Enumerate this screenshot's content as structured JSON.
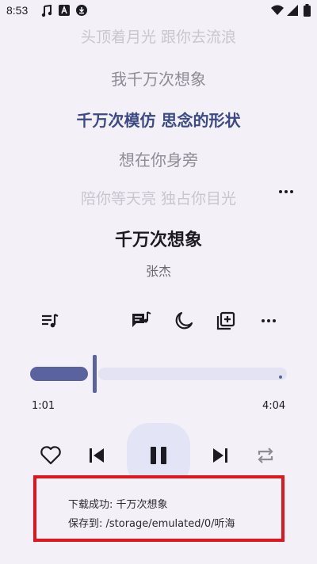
{
  "status_bar": {
    "time": "8:53",
    "left_icons": [
      "music-note-icon",
      "a-badge-icon",
      "download-circle-icon"
    ],
    "right_icons": [
      "wifi-icon",
      "signal-icon",
      "battery-icon"
    ]
  },
  "lyrics": {
    "lines": [
      "头顶着月光 跟你去流浪",
      "我千万次想象",
      "千万次模仿 思念的形状",
      "想在你身旁",
      "陪你等天亮 独占你目光"
    ],
    "active_index": 2
  },
  "song": {
    "title": "千万次想象",
    "artist": "张杰"
  },
  "toolbar": {
    "icons": [
      "playlist-icon",
      "lyrics-icon",
      "sleep-timer-icon",
      "add-to-playlist-icon",
      "more-icon"
    ]
  },
  "playback": {
    "current_time": "1:01",
    "total_time": "4:04",
    "progress_fraction": 0.25
  },
  "controls": {
    "icons": [
      "heart-icon",
      "previous-icon",
      "pause-icon",
      "next-icon",
      "repeat-icon"
    ]
  },
  "toast": {
    "line1": "下载成功: 千万次想象",
    "line2": "保存到: /storage/emulated/0/听海"
  },
  "colors": {
    "background": "#f3f0f8",
    "accent": "#5a62a0",
    "active_lyric": "#3b4a86",
    "highlight_border": "#e0161c"
  }
}
